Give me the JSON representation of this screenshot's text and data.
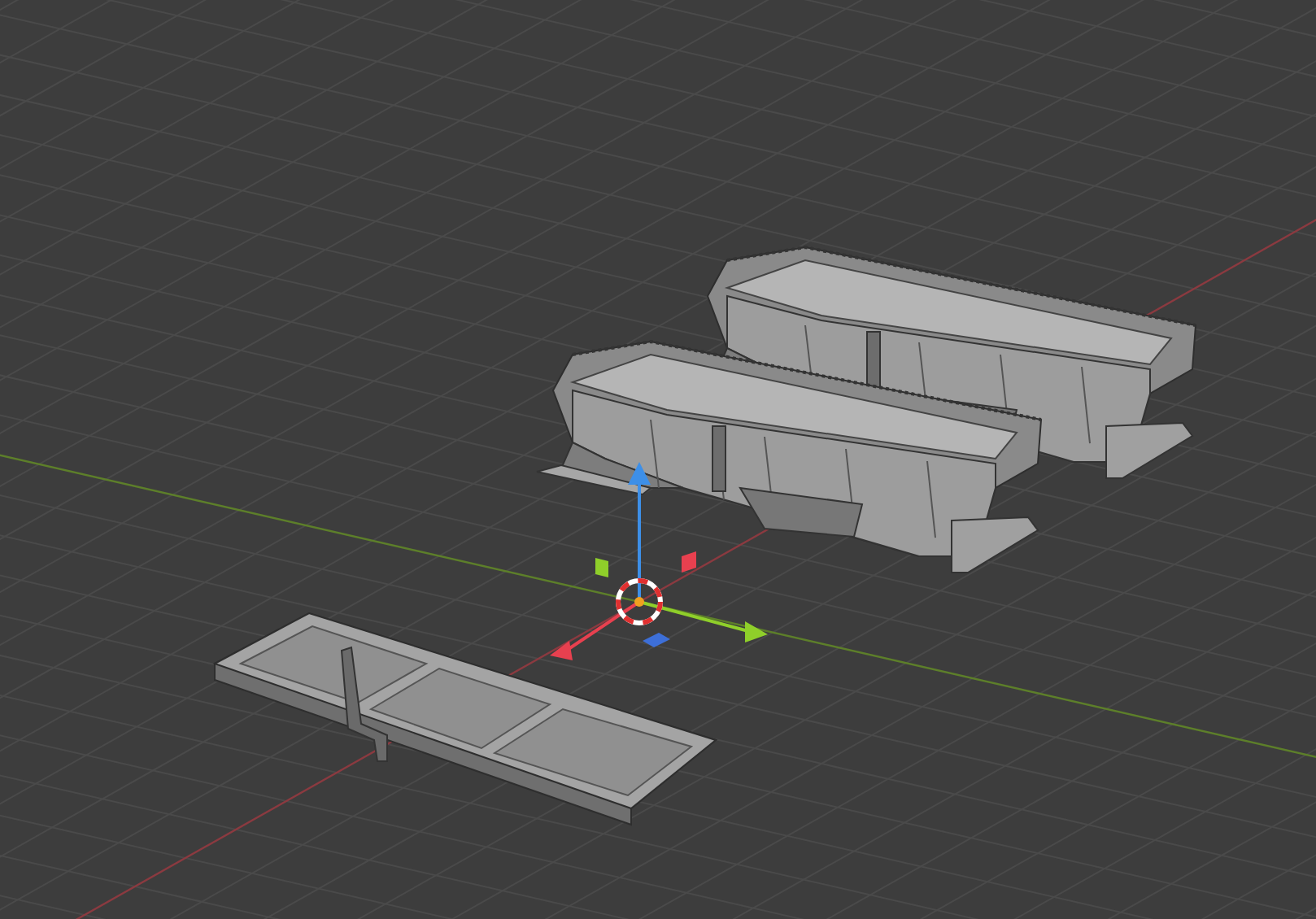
{
  "viewport": {
    "show_grid": true,
    "gizmo": {
      "kind": "move"
    },
    "objects": [
      {
        "kind": "hopper"
      },
      {
        "kind": "hopper"
      },
      {
        "kind": "tray"
      }
    ]
  }
}
